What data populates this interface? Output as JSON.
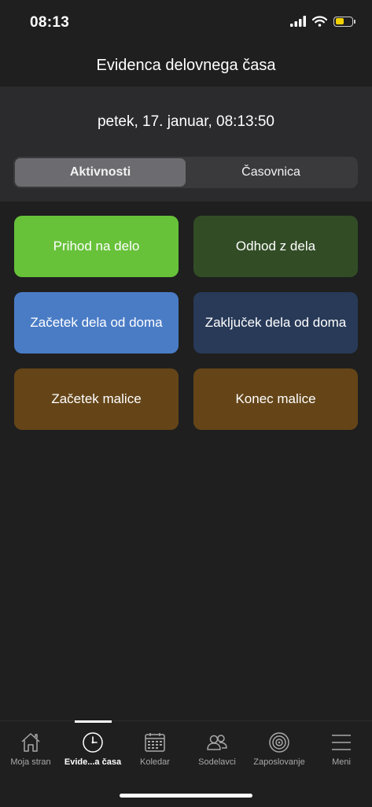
{
  "status_bar": {
    "time": "08:13",
    "battery_level": 0.55,
    "battery_color": "#f2d100"
  },
  "nav": {
    "title": "Evidenca delovnega časa"
  },
  "date_line": "petek, 17. januar, 08:13:50",
  "segments": [
    {
      "label": "Aktivnosti",
      "selected": true
    },
    {
      "label": "Časovnica",
      "selected": false
    }
  ],
  "actions": [
    {
      "label": "Prihod na delo",
      "color": "#67c23a"
    },
    {
      "label": "Odhod z dela",
      "color": "#324d26"
    },
    {
      "label": "Začetek dela od doma",
      "color": "#4a7cc6"
    },
    {
      "label": "Zaključek dela od doma",
      "color": "#283a58"
    },
    {
      "label": "Začetek malice",
      "color": "#654518"
    },
    {
      "label": "Konec malice",
      "color": "#654518"
    }
  ],
  "tabs": [
    {
      "label": "Moja stran",
      "icon": "home-icon"
    },
    {
      "label": "Evide...a časa",
      "icon": "clock-icon",
      "active": true
    },
    {
      "label": "Koledar",
      "icon": "calendar-icon"
    },
    {
      "label": "Sodelavci",
      "icon": "people-icon"
    },
    {
      "label": "Zaposlovanje",
      "icon": "target-icon"
    },
    {
      "label": "Meni",
      "icon": "menu-icon"
    }
  ]
}
